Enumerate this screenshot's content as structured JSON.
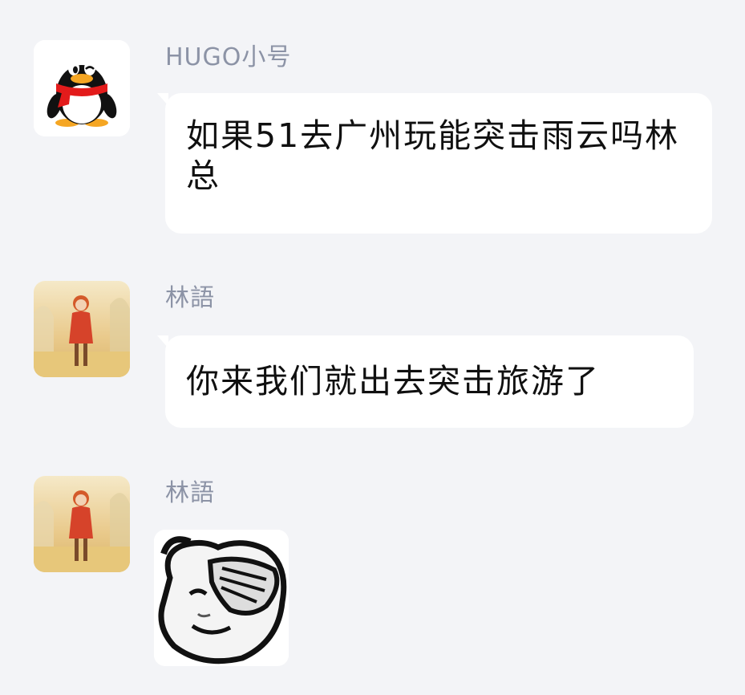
{
  "messages": [
    {
      "sender": "HUGO小号",
      "avatar_icon": "qq-penguin-icon",
      "text": "如果51去广州玩能突击雨云吗林总"
    },
    {
      "sender": "林語",
      "avatar_icon": "anime-girl-avatar",
      "text": "你来我们就出去突击旅游了"
    },
    {
      "sender": "林語",
      "avatar_icon": "anime-girl-avatar",
      "sticker_icon": "facepalm-panda-sticker"
    }
  ],
  "colors": {
    "background": "#f3f4f7",
    "bubble": "#ffffff",
    "sender_name": "#8c93a6",
    "message_text": "#101010"
  }
}
